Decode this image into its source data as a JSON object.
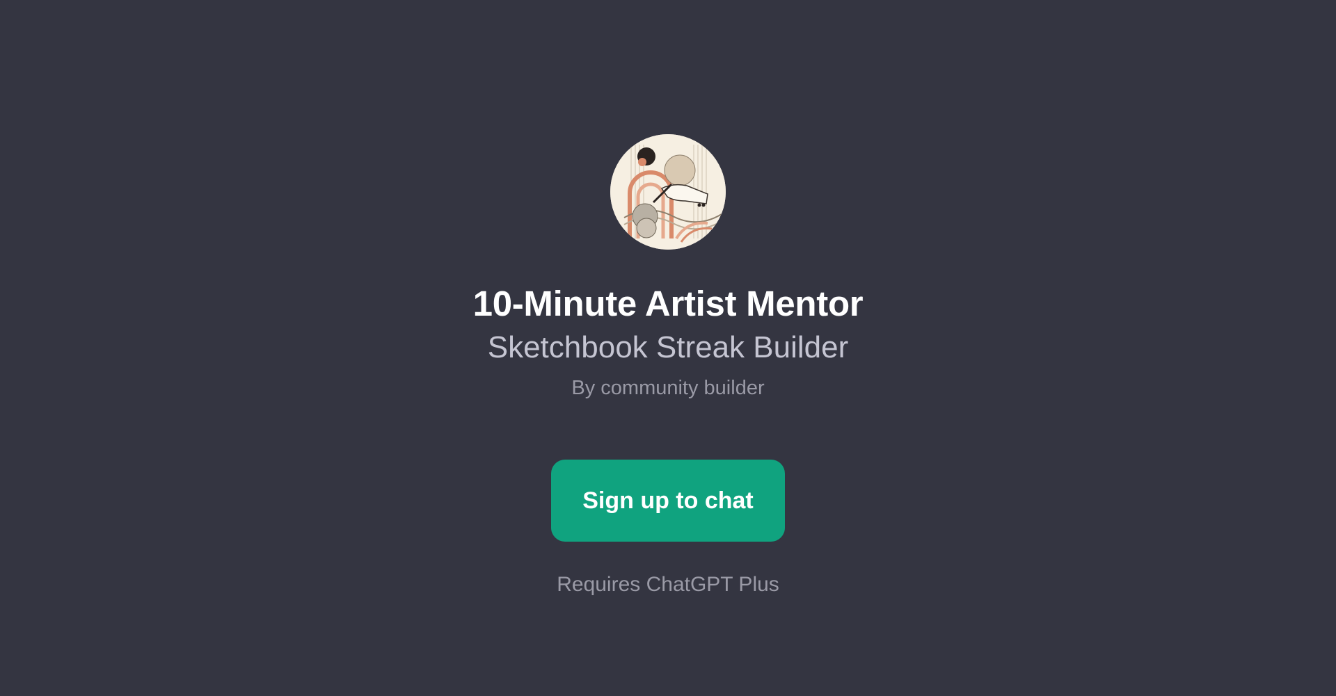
{
  "gpt": {
    "title": "10-Minute Artist Mentor",
    "subtitle": "Sketchbook Streak Builder",
    "byline": "By community builder",
    "avatar_icon": "sketch-hand-illustration-icon"
  },
  "cta": {
    "label": "Sign up to chat",
    "color": "#10a37f"
  },
  "footer": {
    "requires": "Requires ChatGPT Plus"
  },
  "theme": {
    "background": "#343541"
  }
}
